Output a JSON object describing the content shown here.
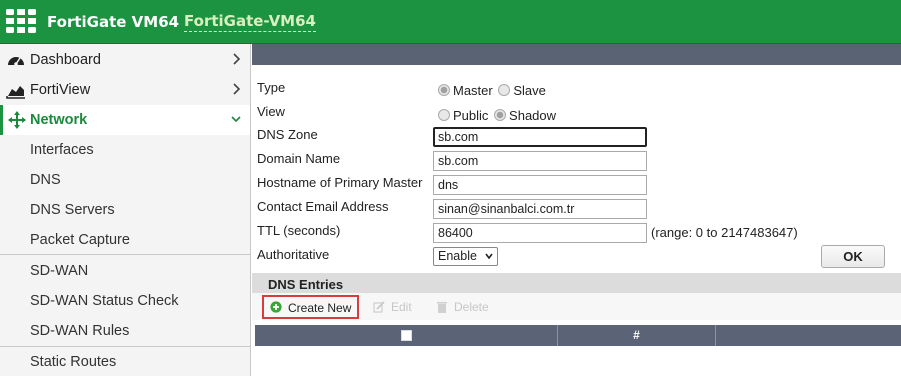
{
  "header": {
    "brand": "FortiGate VM64",
    "hostname": "FortiGate-VM64",
    "brand_color": "#1c9340",
    "logo_icon": "fortinet-logo-icon"
  },
  "sidebar": {
    "items": [
      {
        "label": "Dashboard",
        "icon": "dashboard-icon"
      },
      {
        "label": "FortiView",
        "icon": "chart-icon"
      },
      {
        "label": "Network",
        "icon": "move-arrows-icon"
      }
    ],
    "network_sub": [
      "Interfaces",
      "DNS",
      "DNS Servers",
      "Packet Capture",
      "SD-WAN",
      "SD-WAN Status Check",
      "SD-WAN Rules",
      "Static Routes"
    ]
  },
  "form": {
    "type_label": "Type",
    "type_options": [
      "Master",
      "Slave"
    ],
    "type_selected": "Master",
    "view_label": "View",
    "view_options": [
      "Public",
      "Shadow"
    ],
    "view_selected": "Shadow",
    "dns_zone_label": "DNS Zone",
    "dns_zone_value": "sb.com",
    "domain_name_label": "Domain Name",
    "domain_name_value": "sb.com",
    "hostname_label": "Hostname of Primary Master",
    "hostname_value": "dns",
    "email_label": "Contact Email Address",
    "email_value": "sinan@sinanbalci.com.tr",
    "ttl_label": "TTL (seconds)",
    "ttl_value": "86400",
    "ttl_range": "(range: 0 to 2147483647)",
    "authoritative_label": "Authoritative",
    "authoritative_value": "Enable",
    "ok_label": "OK"
  },
  "dns_entries": {
    "title": "DNS Entries",
    "create_new": "Create New",
    "edit": "Edit",
    "delete": "Delete",
    "columns": [
      "",
      "#",
      ""
    ]
  }
}
